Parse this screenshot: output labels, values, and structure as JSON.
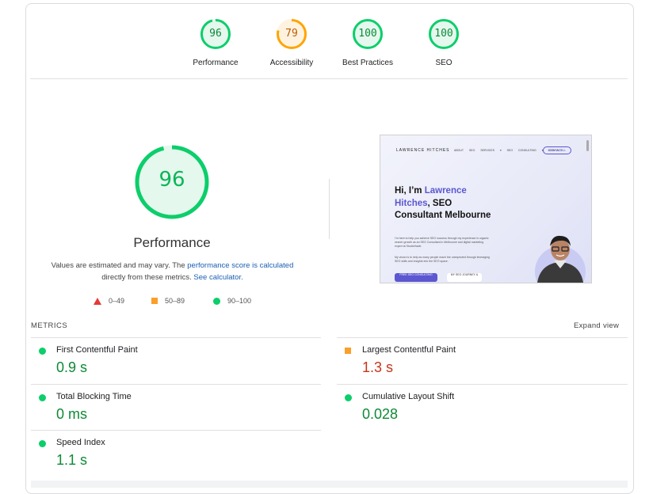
{
  "summary_gauges": [
    {
      "label": "Performance",
      "score": "96",
      "fraction": 0.96,
      "color": "#0cce6b",
      "text_color": "#0a8a3a",
      "fill": "#e5f8ed"
    },
    {
      "label": "Accessibility",
      "score": "79",
      "fraction": 0.79,
      "color": "#ffa400",
      "text_color": "#c05a00",
      "fill": "#fff3e0"
    },
    {
      "label": "Best Practices",
      "score": "100",
      "fraction": 1.0,
      "color": "#0cce6b",
      "text_color": "#0a8a3a",
      "fill": "#e5f8ed"
    },
    {
      "label": "SEO",
      "score": "100",
      "fraction": 1.0,
      "color": "#0cce6b",
      "text_color": "#0a8a3a",
      "fill": "#e5f8ed"
    }
  ],
  "performance": {
    "score": "96",
    "fraction": 0.96,
    "title": "Performance",
    "desc_prefix": "Values are estimated and may vary. The ",
    "desc_link1": "performance score is calculated",
    "desc_middle": " directly from these metrics. ",
    "desc_link2": "See calculator.",
    "legend": [
      {
        "icon": "red-triangle-icon",
        "label": "0–49"
      },
      {
        "icon": "orange-square-icon",
        "label": "50–89"
      },
      {
        "icon": "green-circle-icon",
        "label": "90–100"
      }
    ]
  },
  "screenshot": {
    "brand": "LAWRENCE HITCHES",
    "nav_links": "ABOUT SEO SERVICES ▾ SEO CONSULTING ▾ CONTACT",
    "book_button": "BOOK A CALL",
    "headline_1": "Hi, I’m ",
    "headline_highlight": "Lawrence Hitches",
    "headline_2": ", SEO Consultant Melbourne",
    "body_1": "I’m here to help you achieve SEO success through my experience in organic search growth as an SEO Consultant in Melbourne and digital marketing expert at StudioHawk.",
    "body_2": "My vision is to help as many people reach the unexpected through leveraging SEO skills and insights into the SEO space.",
    "cta_1": "FREE SEO CONSULTING",
    "cta_2": "MY SEO JOURNEY &"
  },
  "metrics": {
    "label": "METRICS",
    "expand": "Expand view",
    "items": [
      {
        "name": "First Contentful Paint",
        "value": "0.9 s",
        "status": "good"
      },
      {
        "name": "Largest Contentful Paint",
        "value": "1.3 s",
        "status": "average"
      },
      {
        "name": "Total Blocking Time",
        "value": "0 ms",
        "status": "good"
      },
      {
        "name": "Cumulative Layout Shift",
        "value": "0.028",
        "status": "good"
      },
      {
        "name": "Speed Index",
        "value": "1.1 s",
        "status": "good"
      }
    ]
  }
}
